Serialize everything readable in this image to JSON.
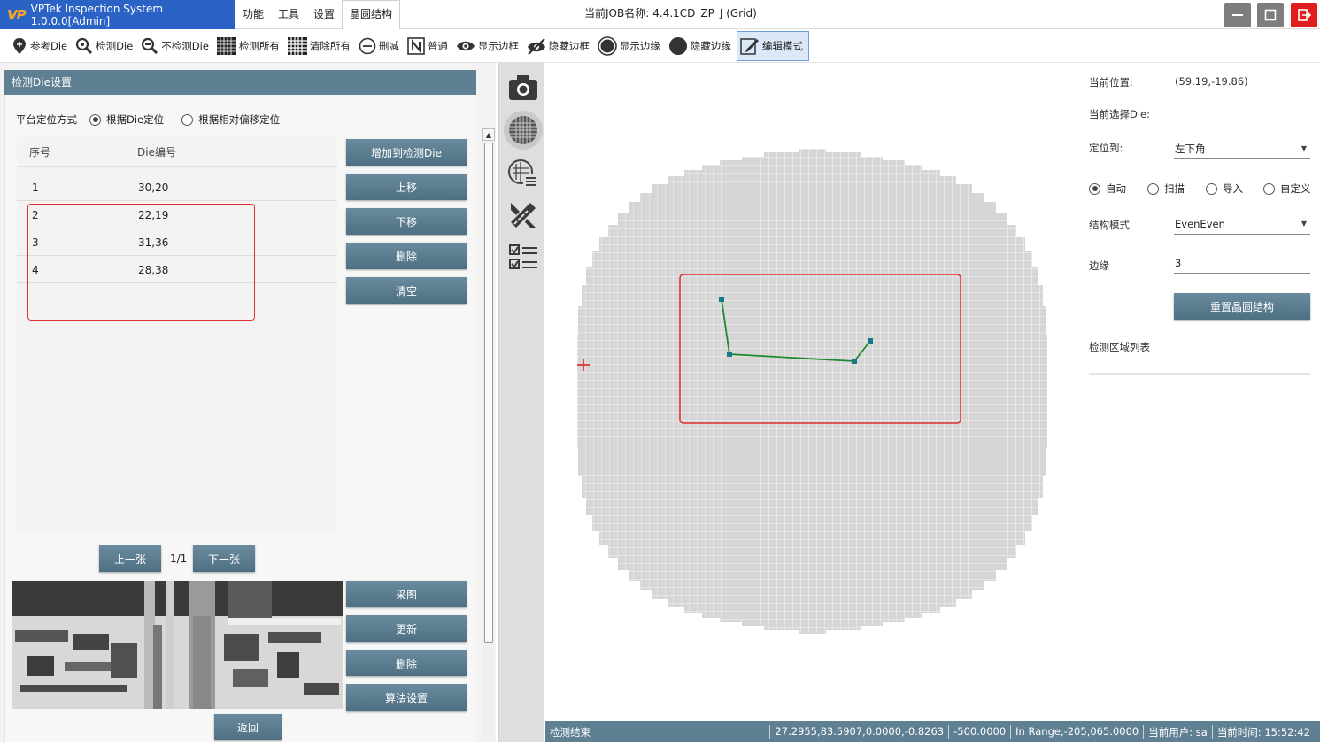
{
  "app": {
    "logo": "VP",
    "title": "VPTek Inspection System 1.0.0.0[Admin]",
    "job_label": "当前JOB名称:",
    "job_name": "4.4.1CD_ZP_J (Grid)"
  },
  "menu": [
    "功能",
    "工具",
    "设置",
    "晶圆结构"
  ],
  "toolbar": [
    {
      "label": "参考Die",
      "icon": "pin-icon"
    },
    {
      "label": "检测Die",
      "icon": "zoom-icon"
    },
    {
      "label": "不检测Die",
      "icon": "zoom-icon"
    },
    {
      "label": "检测所有",
      "icon": "grid-icon"
    },
    {
      "label": "清除所有",
      "icon": "grid-icon"
    },
    {
      "label": "删减",
      "icon": "minus-circle-icon"
    },
    {
      "label": "普通",
      "icon": "n-box-icon"
    },
    {
      "label": "显示边框",
      "icon": "eye-icon"
    },
    {
      "label": "隐藏边框",
      "icon": "eye-off-icon"
    },
    {
      "label": "显示边缘",
      "icon": "circle-icon"
    },
    {
      "label": "隐藏边缘",
      "icon": "circle-icon"
    },
    {
      "label": "编辑模式",
      "icon": "edit-icon"
    }
  ],
  "left_panel": {
    "header": "检测Die设置",
    "locate_label": "平台定位方式",
    "radio_die": "根据Die定位",
    "radio_offset": "根据相对偏移定位",
    "col_index": "序号",
    "col_die": "Die编号",
    "rows": [
      {
        "index": "1",
        "die": "30,20"
      },
      {
        "index": "2",
        "die": "22,19"
      },
      {
        "index": "3",
        "die": "31,36"
      },
      {
        "index": "4",
        "die": "28,38"
      }
    ],
    "btn_add": "增加到检测Die",
    "btn_up": "上移",
    "btn_down": "下移",
    "btn_delete": "删除",
    "btn_clear": "清空",
    "btn_prev": "上一张",
    "page": "1/1",
    "btn_next": "下一张",
    "btn_capture": "采图",
    "btn_update": "更新",
    "btn_delete2": "删除",
    "btn_algo": "算法设置",
    "btn_back": "返回"
  },
  "right_panel": {
    "pos_label": "当前位置:",
    "pos_value": "(59.19,-19.86)",
    "sel_die_label": "当前选择Die:",
    "locate_to_label": "定位到:",
    "locate_to_value": "左下角",
    "mode_auto": "自动",
    "mode_scan": "扫描",
    "mode_import": "导入",
    "mode_custom": "自定义",
    "struct_label": "结构模式",
    "struct_value": "EvenEven",
    "edge_label": "边缘",
    "edge_value": "3",
    "btn_reset": "重置晶圆结构",
    "region_list_label": "检测区域列表"
  },
  "status": {
    "left": "检测结束",
    "coords": "27.2955,83.5907,0.0000,-0.8263",
    "z": "-500.0000",
    "range": "In Range,-205,065.0000",
    "user_label": "当前用户:",
    "user": "sa",
    "time_label": "当前时间:",
    "time": "15:52:42"
  },
  "colors": {
    "accent": "#5f7f93",
    "title_bg": "#2b62c6",
    "close": "#e02020",
    "highlight": "#e03030",
    "path": "#1e8a2e"
  }
}
